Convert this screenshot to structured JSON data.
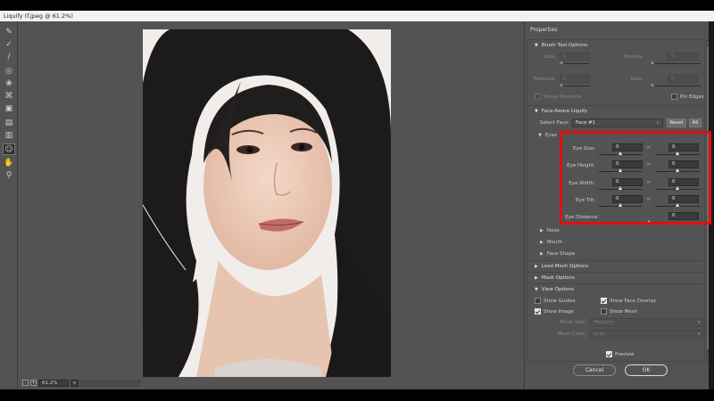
{
  "window": {
    "title": "Liquify (f.jpeg @ 61.2%)"
  },
  "toolbar": {
    "tools": [
      {
        "name": "forward-warp-icon",
        "glyph": "✎"
      },
      {
        "name": "reconstruct-icon",
        "glyph": "✓"
      },
      {
        "name": "smooth-icon",
        "glyph": "∕"
      },
      {
        "name": "twirl-icon",
        "glyph": "◎"
      },
      {
        "name": "pucker-icon",
        "glyph": "❀"
      },
      {
        "name": "bloat-icon",
        "glyph": "⌘"
      },
      {
        "name": "push-left-icon",
        "glyph": "▣"
      },
      {
        "name": "freeze-mask-icon",
        "glyph": "▤"
      },
      {
        "name": "thaw-mask-icon",
        "glyph": "▥"
      },
      {
        "name": "face-tool-icon",
        "glyph": "☺"
      },
      {
        "name": "hand-icon",
        "glyph": "✋"
      },
      {
        "name": "zoom-icon",
        "glyph": "⚲"
      }
    ]
  },
  "zoom": {
    "minus": "-",
    "plus": "+",
    "value": "61.2%",
    "drop": "∨"
  },
  "properties": {
    "title": "Properties",
    "brush": {
      "title": "Brush Tool Options",
      "size_label": "Size:",
      "size_value": "1",
      "density_label": "Density:",
      "density_value": "0",
      "pressure_label": "Pressure:",
      "pressure_value": "1",
      "rate_label": "Rate:",
      "rate_value": "0",
      "stylus_label": "Stylus Pressure",
      "pin_edges_label": "Pin Edges"
    },
    "face": {
      "title": "Face-Aware Liquify",
      "select_face_label": "Select Face:",
      "select_face_value": "Face #1",
      "reset_label": "Reset",
      "all_label": "All",
      "eyes": {
        "title": "Eyes",
        "eye_size_label": "Eye Size:",
        "eye_size_left": "0",
        "eye_size_right": "0",
        "eye_height_label": "Eye Height:",
        "eye_height_left": "0",
        "eye_height_right": "0",
        "eye_width_label": "Eye Width:",
        "eye_width_left": "0",
        "eye_width_right": "0",
        "eye_tilt_label": "Eye Tilt:",
        "eye_tilt_left": "0",
        "eye_tilt_right": "0",
        "eye_distance_label": "Eye Distance:",
        "eye_distance_value": "0"
      },
      "nose_label": "Nose",
      "mouth_label": "Mouth",
      "face_shape_label": "Face Shape"
    },
    "load_mesh_label": "Load Mesh Options",
    "mask_label": "Mask Options",
    "view": {
      "title": "View Options",
      "show_guides": "Show Guides",
      "show_face_overlay": "Show Face Overlay",
      "show_image": "Show Image",
      "show_mesh": "Show Mesh",
      "mesh_size_label": "Mesh Size:",
      "mesh_size_value": "Medium",
      "mesh_color_label": "Mesh Color:",
      "mesh_color_value": "Gray"
    }
  },
  "footer": {
    "preview_label": "Preview",
    "cancel_label": "Cancel",
    "ok_label": "OK"
  },
  "colors": {
    "panel": "#535353",
    "highlight": "#e01010"
  }
}
